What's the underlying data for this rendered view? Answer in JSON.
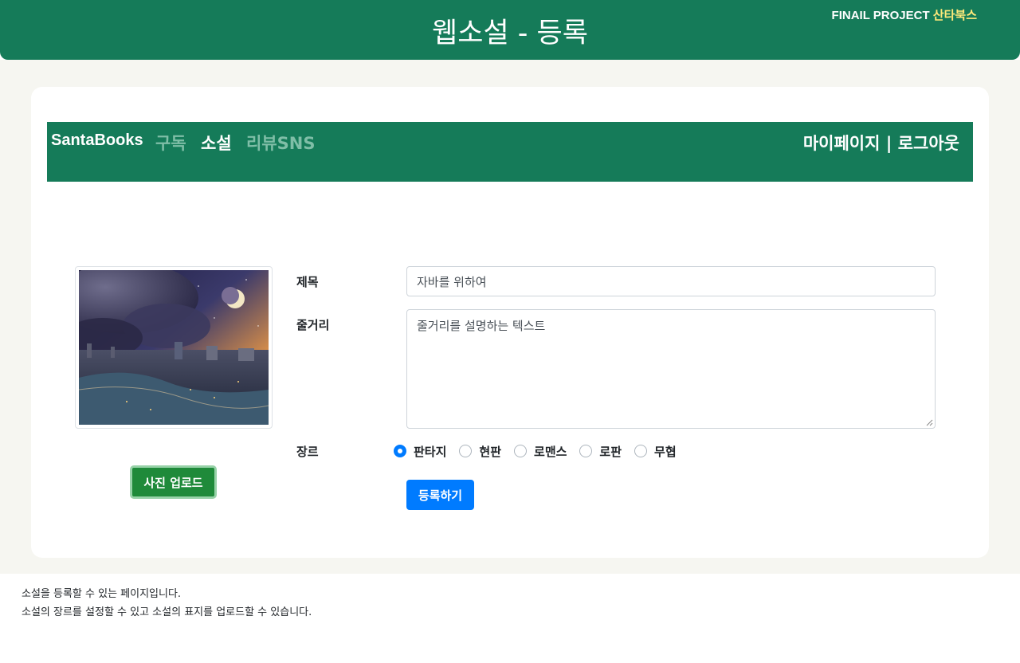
{
  "header": {
    "title": "웹소설 - 등록",
    "brand_prefix": "FINAIL PROJECT",
    "brand_accent": "산타북스",
    "bg_color": "#157b59",
    "accent_color": "#ffe97a"
  },
  "navbar": {
    "brand": "SantaBooks",
    "links": [
      {
        "label": "구독",
        "active": false
      },
      {
        "label": "소설",
        "active": true
      },
      {
        "label": "리뷰SNS",
        "active": false
      }
    ],
    "right": "마이페이지 | 로그아웃"
  },
  "form": {
    "title_label": "제목",
    "title_value": "자바를 위하여",
    "plot_label": "줄거리",
    "plot_value": "줄거리를 설명하는 텍스트",
    "genre_label": "장르",
    "genres": [
      {
        "label": "판타지",
        "checked": true
      },
      {
        "label": "현판",
        "checked": false
      },
      {
        "label": "로맨스",
        "checked": false
      },
      {
        "label": "로판",
        "checked": false
      },
      {
        "label": "무협",
        "checked": false
      }
    ],
    "submit_label": "등록하기",
    "upload_label": "사진 업로드",
    "submit_color": "#007bff",
    "upload_color": "#1f8a3a"
  },
  "footer": {
    "line1": "소설을 등록할 수 있는 페이지입니다.",
    "line2": "소설의 장르를 설정할 수 있고 소설의 표지를 업로드할 수 있습니다."
  }
}
